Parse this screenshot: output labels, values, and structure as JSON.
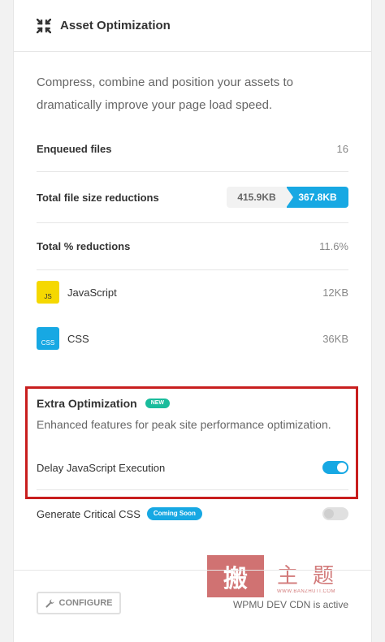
{
  "card": {
    "title": "Asset Optimization",
    "description": "Compress, combine and position your assets to dramatically improve your page load speed."
  },
  "stats": {
    "enqueued_label": "Enqueued files",
    "enqueued_value": "16",
    "size_label": "Total file size reductions",
    "size_before": "415.9KB",
    "size_after": "367.8KB",
    "percent_label": "Total % reductions",
    "percent_value": "11.6%"
  },
  "files": [
    {
      "badge": "JS",
      "name": "JavaScript",
      "size": "12KB",
      "color": "#f5d800"
    },
    {
      "badge": "CSS",
      "name": "CSS",
      "size": "36KB",
      "color": "#17a8e3"
    }
  ],
  "extra": {
    "title": "Extra Optimization",
    "tag": "NEW",
    "description": "Enhanced features for peak site performance optimization.",
    "delay_label": "Delay JavaScript Execution",
    "delay_enabled": true,
    "critical_label": "Generate Critical CSS",
    "critical_tag": "Coming Soon",
    "critical_enabled": false
  },
  "footer": {
    "configure_label": "CONFIGURE",
    "cdn_status": "WPMU DEV CDN is active"
  },
  "watermark": {
    "seal": "搬",
    "chars": "主题",
    "url": "WWW.BANZHUTI.COM"
  },
  "colors": {
    "accent": "#17a8e3",
    "js_badge": "#f5d800",
    "new_tag": "#1abc9c",
    "highlight_box": "#c81e1e"
  },
  "icons": {
    "header": "compress-arrows-icon",
    "configure": "wrench-icon"
  }
}
